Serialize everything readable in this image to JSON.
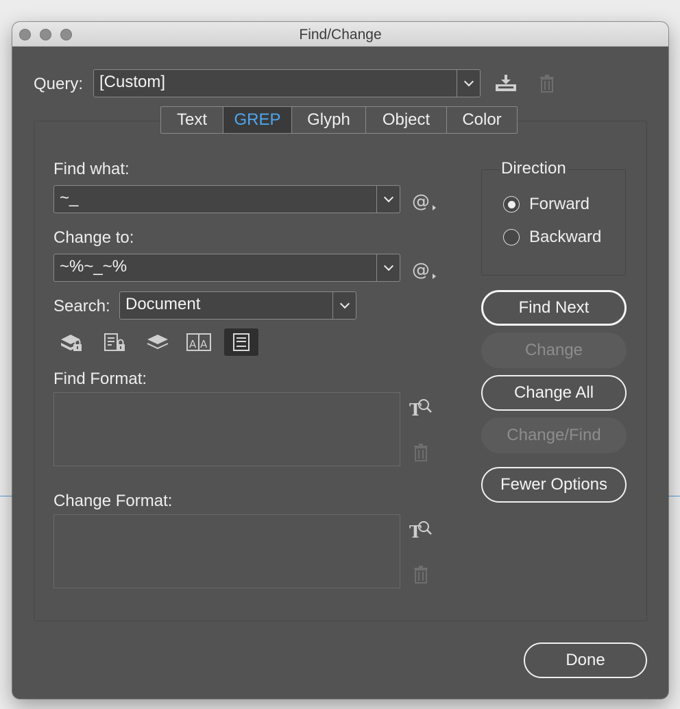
{
  "window": {
    "title": "Find/Change"
  },
  "query": {
    "label": "Query:",
    "value": "[Custom]",
    "save_icon": "save-query-icon",
    "delete_icon": "trash-icon"
  },
  "tabs": [
    {
      "label": "Text",
      "active": false
    },
    {
      "label": "GREP",
      "active": true
    },
    {
      "label": "Glyph",
      "active": false
    },
    {
      "label": "Object",
      "active": false
    },
    {
      "label": "Color",
      "active": false
    }
  ],
  "find_what": {
    "label": "Find what:",
    "value": "~_"
  },
  "change_to": {
    "label": "Change to:",
    "value": "~%~_~%"
  },
  "search": {
    "label": "Search:",
    "value": "Document"
  },
  "search_options": [
    {
      "name": "include-locked-layers-icon",
      "active": false
    },
    {
      "name": "include-locked-stories-icon",
      "active": false
    },
    {
      "name": "include-hidden-layers-icon",
      "active": false
    },
    {
      "name": "include-master-pages-icon",
      "active": false
    },
    {
      "name": "include-footnotes-icon",
      "active": true
    }
  ],
  "find_format": {
    "label": "Find Format:"
  },
  "change_format": {
    "label": "Change Format:"
  },
  "direction": {
    "label": "Direction",
    "options": [
      {
        "label": "Forward",
        "selected": true
      },
      {
        "label": "Backward",
        "selected": false
      }
    ]
  },
  "buttons": {
    "find_next": "Find Next",
    "change": "Change",
    "change_all": "Change All",
    "change_find": "Change/Find",
    "fewer_options": "Fewer Options",
    "done": "Done"
  },
  "colors": {
    "dialog_bg": "#535353",
    "active_tab_text": "#4ea6f0",
    "field_bg": "#444444"
  }
}
